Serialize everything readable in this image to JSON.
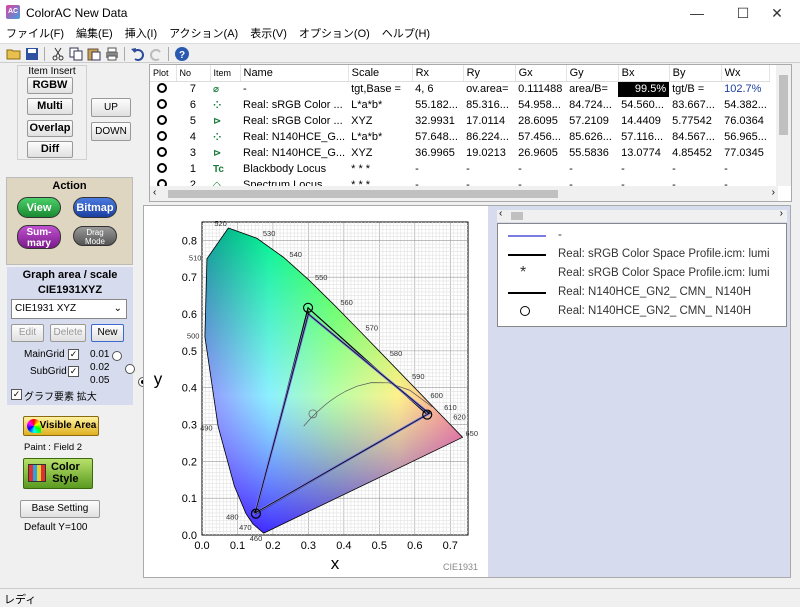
{
  "window": {
    "title": "ColorAC  New Data",
    "icon": "AC",
    "controls": {
      "minimize": "—",
      "maximize": "☐",
      "close": "✕"
    }
  },
  "menu": [
    "ファイル(F)",
    "編集(E)",
    "挿入(I)",
    "アクション(A)",
    "表示(V)",
    "オプション(O)",
    "ヘルプ(H)"
  ],
  "toolbar": {
    "icons": [
      "open-folder-icon",
      "save-icon",
      "cut-icon",
      "copy-icon",
      "paste-icon",
      "print-icon",
      "undo-icon",
      "redo-icon",
      "help-icon"
    ]
  },
  "left": {
    "item_insert": {
      "title": "Item Insert",
      "rgbw": "RGBW",
      "multi": "Multi",
      "overlap": "Overlap",
      "diff": "Diff",
      "up": "UP",
      "down": "DOWN"
    },
    "action": {
      "title": "Action",
      "view": "View",
      "bitmap": "Bitmap",
      "summary": "Sum-\nmary",
      "dragmode": "Drag\nMode"
    },
    "graph": {
      "title": "Graph area / scale",
      "scale": "CIE1931XYZ",
      "select": "CIE1931 XYZ",
      "edit": "Edit",
      "delete": "Delete",
      "new": "New",
      "maingrid": "MainGrid",
      "subgrid": "SubGrid",
      "r1": "0.01",
      "r2": "0.02",
      "r3": "0.05",
      "expand": "グラフ要素 拡大"
    },
    "visible_area": "Visible Area",
    "paint": "Paint : Field 2",
    "color_style": "Color\nStyle",
    "base_setting": "Base Setting",
    "default_y": "Default Y=100"
  },
  "table": {
    "headers": [
      "Plot",
      "No",
      "Item",
      "Name",
      "Scale",
      "Rx",
      "Ry",
      "Gx",
      "Gy",
      "Bx",
      "By",
      "Wx"
    ],
    "rows": [
      [
        "7",
        "-",
        "tgt,Base =",
        "  4,  6",
        "ov.area=",
        "0.111488",
        "area/B=",
        "99.5%",
        "tgt/B =",
        "102.7%"
      ],
      [
        "6",
        "Real: sRGB Color ...",
        "L*a*b*",
        "55.182...",
        "85.316...",
        "54.958...",
        "84.724...",
        "54.560...",
        "83.667...",
        "54.382..."
      ],
      [
        "5",
        "Real: sRGB Color ...",
        "  XYZ",
        "32.9931",
        "17.0114",
        "28.6095",
        "57.2109",
        "14.4409",
        "5.77542",
        "76.0364"
      ],
      [
        "4",
        "Real: N140HCE_G...",
        "L*a*b*",
        "57.648...",
        "86.224...",
        "57.456...",
        "85.626...",
        "57.116...",
        "84.567...",
        "56.965..."
      ],
      [
        "3",
        "Real: N140HCE_G...",
        "  XYZ",
        "36.9965",
        "19.0213",
        "26.9605",
        "55.5836",
        "13.0774",
        "4.85452",
        "77.0345"
      ],
      [
        "1",
        "Blackbody Locus",
        "  * * *",
        "  -",
        "  -",
        "  -",
        "  -",
        "  -",
        "  -",
        "  -"
      ],
      [
        "2",
        "Spectrum Locus",
        "  * * *",
        "  -",
        "  -",
        "  -",
        "  -",
        "  -",
        "  -",
        "  -"
      ]
    ]
  },
  "chart": {
    "xlabel": "x",
    "ylabel": "y",
    "name": "CIE1931",
    "xticks": [
      "0.0",
      "0.1",
      "0.2",
      "0.3",
      "0.4",
      "0.5",
      "0.6",
      "0.7"
    ],
    "yticks": [
      "0.0",
      "0.1",
      "0.2",
      "0.3",
      "0.4",
      "0.5",
      "0.6",
      "0.7",
      "0.8"
    ],
    "wl": [
      "520",
      "530",
      "540",
      "510",
      "550",
      "560",
      "500",
      "570",
      "580",
      "590",
      "490",
      "600",
      "610",
      "620",
      "650",
      "480",
      "470",
      "460"
    ]
  },
  "chart_data": {
    "type": "scatter",
    "title": "",
    "xlabel": "x",
    "ylabel": "y",
    "xlim": [
      0,
      0.75
    ],
    "ylim": [
      0,
      0.85
    ],
    "grid": true,
    "series": [
      {
        "name": "Real: sRGB Color Space Profile.icm",
        "x": [
          0.64,
          0.3,
          0.15
        ],
        "y": [
          0.33,
          0.6,
          0.06
        ]
      },
      {
        "name": "Real: N140HCE_GN2_ CMN_",
        "x": [
          0.635,
          0.299,
          0.152
        ],
        "y": [
          0.327,
          0.617,
          0.058
        ]
      }
    ]
  },
  "legend": [
    {
      "label": "-"
    },
    {
      "label": "Real: sRGB Color Space Profile.icm: lumi"
    },
    {
      "label": "Real: sRGB Color Space Profile.icm: lumi"
    },
    {
      "label": "Real: N140HCE_GN2_ CMN_        N140H"
    },
    {
      "label": "Real: N140HCE_GN2_ CMN_        N140H"
    }
  ],
  "status": "レディ",
  "colors": {
    "accent": "#1a3fa0",
    "selected_cell": "#000000",
    "highlight_text": "#1a3fa0"
  }
}
